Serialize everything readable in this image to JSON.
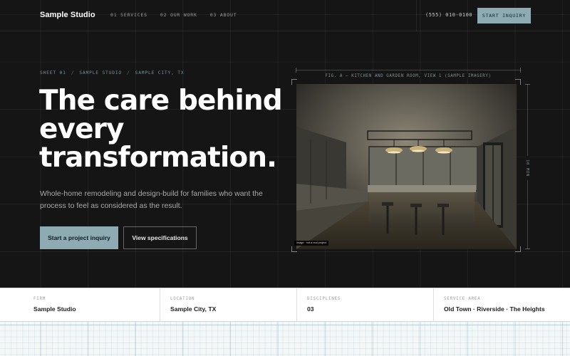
{
  "brand": {
    "name": "Sample Studio"
  },
  "nav": {
    "links": [
      "01 SERVICES",
      "02 OUR WORK",
      "03 ABOUT"
    ],
    "phone": "(555) 010-0100",
    "cta_label": "START INQUIRY"
  },
  "hero": {
    "breadcrumb": [
      "SHEET 01",
      "SAMPLE STUDIO",
      "SAMPLE CITY, TX"
    ],
    "breadcrumb_separator": "/",
    "headline": "The care behind every transformation.",
    "subtext": "Whole-home remodeling and design-build for families who want the process to feel as considered as the result.",
    "primary_button": "Start a project inquiry",
    "secondary_button": "View specifications"
  },
  "figure": {
    "caption": "FIG. A — KITCHEN AND GARDEN ROOM, VIEW 1 (SAMPLE IMAGERY)",
    "dimension_label": "10 MIN",
    "image_tag": "image · not a real project",
    "image_subject": "kitchen-interior-photo"
  },
  "stats": [
    {
      "label": "FIRM",
      "value": "Sample Studio"
    },
    {
      "label": "LOCATION",
      "value": "Sample City, TX"
    },
    {
      "label": "DISCIPLINES",
      "value": "03"
    },
    {
      "label": "SERVICE AREA",
      "value": "Old Town · Riverside · The Heights"
    }
  ],
  "colors": {
    "background": "#151515",
    "accent": "#8eaab3",
    "text_primary": "#ffffff",
    "text_muted": "#a9a9a9",
    "stats_background": "#ffffff"
  }
}
